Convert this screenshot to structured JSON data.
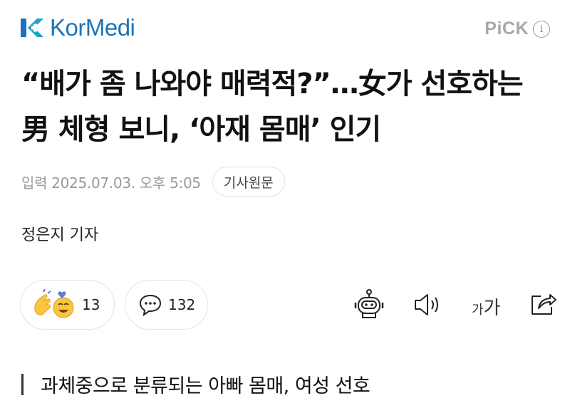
{
  "brand": {
    "logo_text": "KorMedi",
    "pick_label": "PiCK",
    "info_symbol": "i"
  },
  "article": {
    "headline": "“배가 좀 나와야 매력적?”…女가 선호하는 男 체형 보니, ‘아재 몸매’ 인기",
    "date": "입력 2025.07.03. 오후 5:05",
    "original_button": "기사원문",
    "reporter": "정은지 기자",
    "subheading": "과체중으로 분류되는 아빠 몸매, 여성 선호"
  },
  "actions": {
    "reactions_count": "13",
    "comments_count": "132",
    "font_small": "가",
    "font_big": "가"
  },
  "icons": [
    "kormedi-logo-icon",
    "info-icon",
    "reaction-emoji-icon",
    "comment-icon",
    "robot-summary-icon",
    "speaker-icon",
    "font-size-icon",
    "share-icon"
  ],
  "colors": {
    "brand_blue": "#1b74b9",
    "brand_teal": "#18a6c9",
    "muted_gray": "#9a9a9a"
  }
}
